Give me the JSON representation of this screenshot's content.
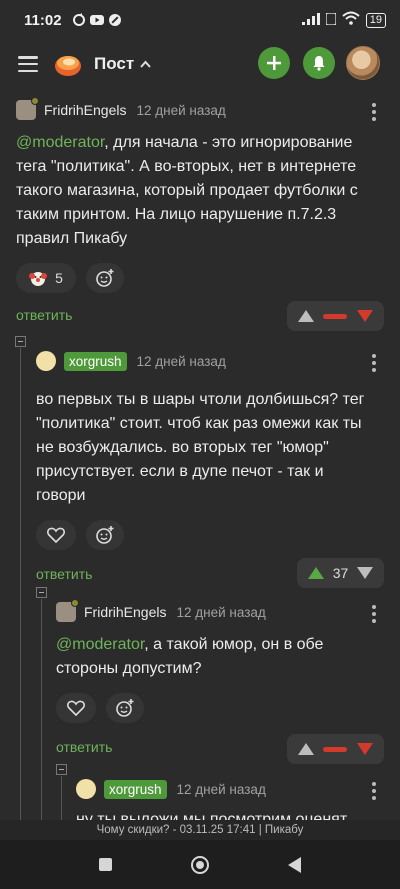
{
  "status": {
    "time": "11:02",
    "battery": "19"
  },
  "appbar": {
    "title": "Пост",
    "add_icon": "plus-icon",
    "bell_icon": "bell-icon"
  },
  "colors": {
    "accent": "#4e9a3a",
    "mention": "#6fb35a",
    "down": "#d33a2c",
    "bg": "#2b2b2b"
  },
  "comments": [
    {
      "author": "FridrihEngels",
      "ago": "12 дней назад",
      "mention": "@moderator",
      "text": ", для начала - это игнорирование тега \"политика\". А во-вторых, нет в интернете такого магазина, который продает футболки с таким принтом. На лицо нарушение п.7.2.3 правил Пикабу",
      "reaction_count": "5",
      "reply": "ответить"
    },
    {
      "author": "xorgrush",
      "ago": "12 дней назад",
      "text": "во первых ты в шары чтоли долбишься? тег \"политика\" стоит. чтоб как раз омежи как ты не возбуждались. во вторых тег \"юмор\" присутствует. если в дупе печот - так и говори",
      "reply": "ответить",
      "score": "37"
    },
    {
      "author": "FridrihEngels",
      "ago": "12 дней назад",
      "mention": "@moderator",
      "text": ", а такой юмор, он в обе стороны допустим?",
      "reply": "ответить"
    },
    {
      "author": "xorgrush",
      "ago": "12 дней назад",
      "text": "ну ты выложи мы посмотрим оценят"
    }
  ],
  "footer": {
    "text": "Чому скидки? - 03.11.25 17:41 | Пикабу"
  }
}
